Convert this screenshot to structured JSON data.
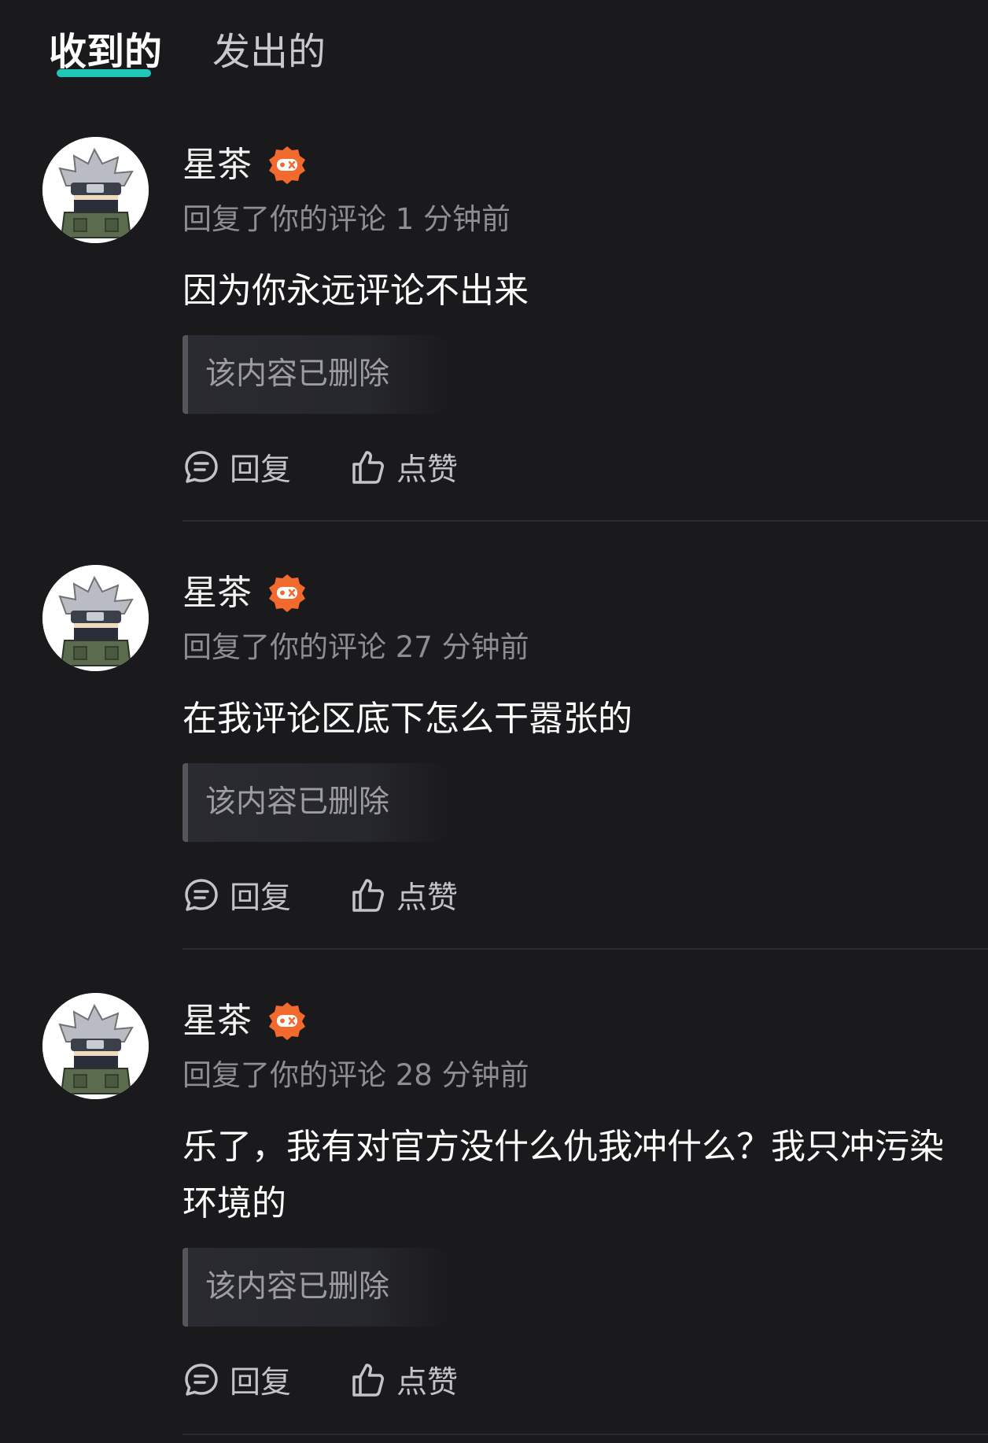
{
  "tabs": [
    {
      "label": "收到的",
      "active": true
    },
    {
      "label": "发出的",
      "active": false
    }
  ],
  "colors": {
    "background": "#1a1a1c",
    "accent_underline": "#1fc7b6",
    "badge": "#f26a2e",
    "meta_text": "#8e8e92"
  },
  "icons": {
    "badge": "game-controller-badge-icon",
    "reply": "comment-bubble-icon",
    "like": "thumbs-up-icon"
  },
  "notifications": [
    {
      "username": "星茶",
      "meta": "回复了你的评论 1 分钟前",
      "comment": "因为你永远评论不出来",
      "quoted": "该内容已删除",
      "reply_label": "回复",
      "like_label": "点赞"
    },
    {
      "username": "星茶",
      "meta": "回复了你的评论 27 分钟前",
      "comment": "在我评论区底下怎么干嚣张的",
      "quoted": "该内容已删除",
      "reply_label": "回复",
      "like_label": "点赞"
    },
    {
      "username": "星茶",
      "meta": "回复了你的评论 28 分钟前",
      "comment": "乐了，我有对官方没什么仇我冲什么？我只冲污染环境的",
      "quoted": "该内容已删除",
      "reply_label": "回复",
      "like_label": "点赞"
    }
  ]
}
